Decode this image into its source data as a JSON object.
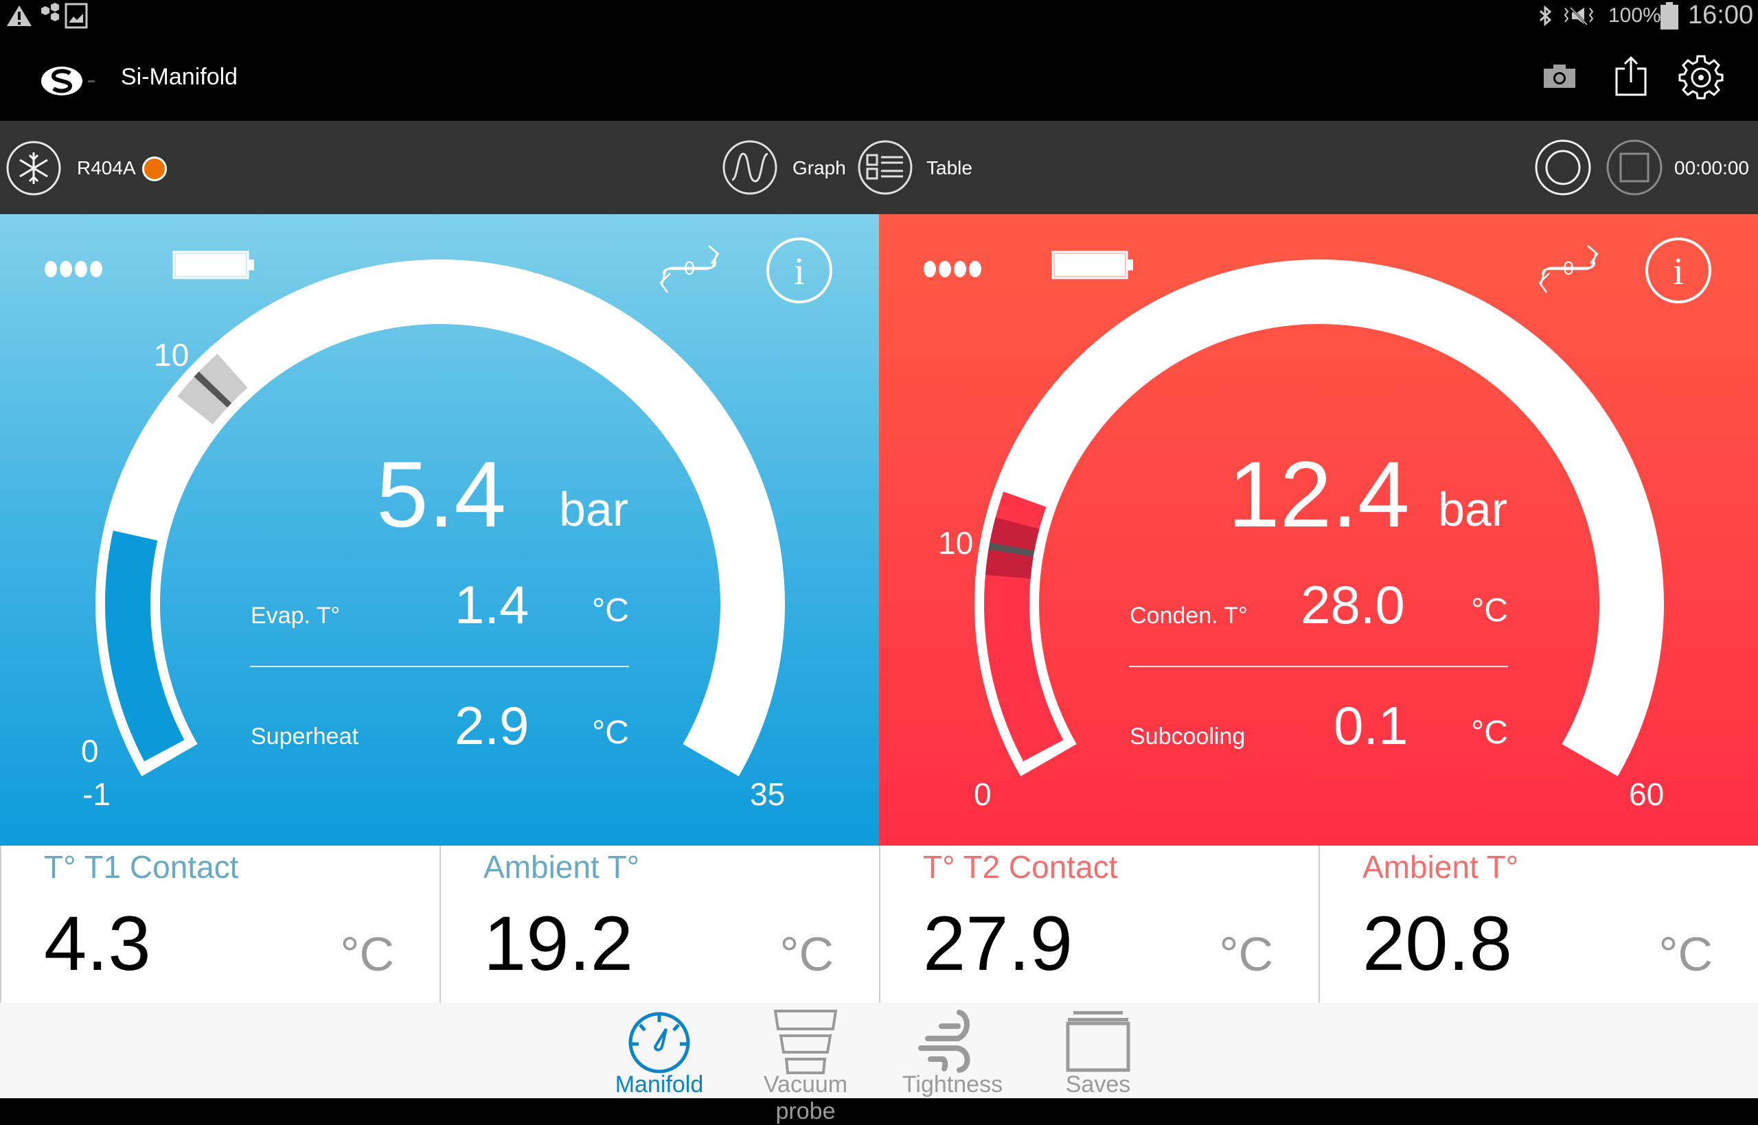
{
  "status_bar": {
    "left_icons": [
      "warning-icon",
      "hexagons-icon",
      "gallery-icon"
    ],
    "right_icons": [
      "bluetooth-icon",
      "vibrate-mute-icon"
    ],
    "battery_percent_text": "100%",
    "time": "16:00"
  },
  "app_bar": {
    "title": "Si-Manifold",
    "actions": [
      "camera-icon",
      "share-icon",
      "settings-icon"
    ]
  },
  "toolbar": {
    "refrigerant": "R404A",
    "refrigerant_dot_color": "#ee7100",
    "graph_label": "Graph",
    "table_label": "Table",
    "timer": "00:00:00"
  },
  "gauges": [
    {
      "id": "low",
      "color": "#2fb0e2",
      "pressure_value": "5.4",
      "pressure_unit": "bar",
      "scale_min_label": "-1",
      "scale_zero_label": "0",
      "scale_mid_label": "10",
      "scale_max_label": "35",
      "scale_min": -1,
      "scale_max": 35,
      "fill_value": 5.4,
      "marker_value": 10,
      "row1_label": "Evap. T°",
      "row1_value": "1.4",
      "row1_unit": "°C",
      "row2_label": "Superheat",
      "row2_value": "2.9",
      "row2_unit": "°C",
      "fill_color": "#0a9ad9",
      "marker_band_color": "#cccccc"
    },
    {
      "id": "high",
      "color": "#ff4345",
      "pressure_value": "12.4",
      "pressure_unit": "bar",
      "scale_min_label": "0",
      "scale_mid_label": "10",
      "scale_max_label": "60",
      "scale_min": 0,
      "scale_max": 60,
      "fill_value": 12.4,
      "marker_value": 10,
      "row1_label": "Conden. T°",
      "row1_value": "28.0",
      "row1_unit": "°C",
      "row2_label": "Subcooling",
      "row2_value": "0.1",
      "row2_unit": "°C",
      "fill_color": "#ff3347",
      "marker_band_color": "#c8203a"
    }
  ],
  "cards": [
    {
      "title": "T° T1 Contact",
      "value": "4.3",
      "unit": "°C",
      "title_color": "#6aa9c4"
    },
    {
      "title": "Ambient T°",
      "value": "19.2",
      "unit": "°C",
      "title_color": "#6aa9c4"
    },
    {
      "title": "T° T2 Contact",
      "value": "27.9",
      "unit": "°C",
      "title_color": "#f07070"
    },
    {
      "title": "Ambient T°",
      "value": "20.8",
      "unit": "°C",
      "title_color": "#f07070"
    }
  ],
  "bottom_nav": {
    "items": [
      {
        "label": "Manifold",
        "icon": "gauge-icon",
        "active": true
      },
      {
        "label": "Vacuum probe",
        "icon": "vacuum-probe-icon",
        "active": false
      },
      {
        "label": "Tightness",
        "icon": "wind-icon",
        "active": false
      },
      {
        "label": "Saves",
        "icon": "saves-icon",
        "active": false
      }
    ],
    "active_color": "#0a84c6",
    "inactive_color": "#9a9a9a"
  }
}
